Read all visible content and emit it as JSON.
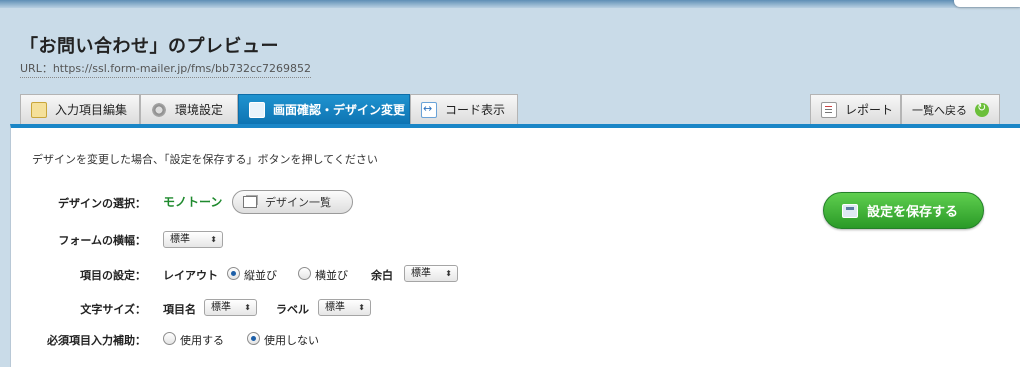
{
  "header": {
    "title": "「お問い合わせ」のプレビュー",
    "url": "URL：https://ssl.form-mailer.jp/fms/bb732cc7269852"
  },
  "tabs": [
    {
      "label": "入力項目編集",
      "icon": "edit-icon",
      "active": false
    },
    {
      "label": "環境設定",
      "icon": "gear-icon",
      "active": false
    },
    {
      "label": "画面確認・デザイン変更",
      "icon": "screen-icon",
      "active": true
    },
    {
      "label": "コード表示",
      "icon": "code-icon",
      "active": false
    }
  ],
  "right_tabs": {
    "report_label": "レポート",
    "back_label": "一覧へ戻る"
  },
  "notice": "デザインを変更した場合、「設定を保存する」ボタンを押してください",
  "design": {
    "label": "デザインの選択：",
    "value": "モノトーン",
    "button_label": "デザイン一覧"
  },
  "form_width": {
    "label": "フォームの横幅：",
    "selected": "標準"
  },
  "item_settings": {
    "label": "項目の設定：",
    "layout_label": "レイアウト",
    "option_vertical": "縦並び",
    "option_horizontal": "横並び",
    "selected_layout": "縦並び",
    "margin_label": "余白",
    "margin_selected": "標準"
  },
  "font_size": {
    "label": "文字サイズ：",
    "item_name_label": "項目名",
    "item_name_selected": "標準",
    "label_label": "ラベル",
    "label_selected": "標準"
  },
  "required_assist": {
    "label": "必須項目入力補助：",
    "option_use": "使用する",
    "option_not_use": "使用しない",
    "selected": "使用しない"
  },
  "save_button_label": "設定を保存する",
  "colors": {
    "accent": "#1a86c7",
    "save_green": "#2a9a27",
    "design_value": "#1f8a2e"
  }
}
